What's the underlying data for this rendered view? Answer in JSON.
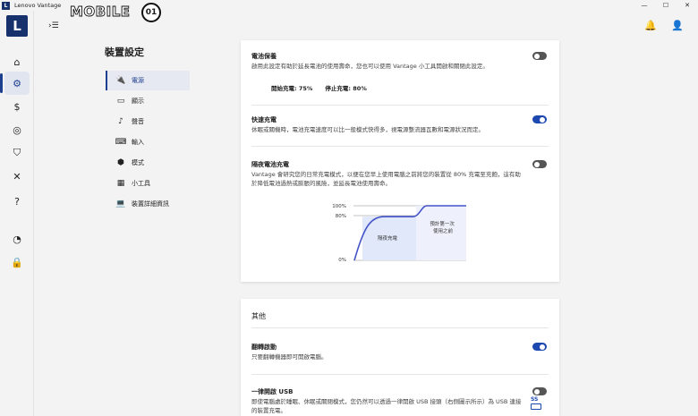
{
  "window": {
    "title": "Lenovo Vantage",
    "badge": "L",
    "minimize": "—",
    "maximize": "☐",
    "close": "✕"
  },
  "watermark": {
    "text": "MOBILE",
    "seal": "01"
  },
  "rail": {
    "logo": "L",
    "icons": [
      {
        "name": "home-icon",
        "glyph": "⌂"
      },
      {
        "name": "gear-icon",
        "glyph": "⚙"
      },
      {
        "name": "dollar-icon",
        "glyph": "$"
      },
      {
        "name": "swirl-icon",
        "glyph": "◎"
      },
      {
        "name": "shield-icon",
        "glyph": "⛉"
      },
      {
        "name": "tools-icon",
        "glyph": "✕"
      },
      {
        "name": "help-icon",
        "glyph": "?"
      },
      {
        "name": "speedometer-icon",
        "glyph": "◔"
      },
      {
        "name": "lock-icon",
        "glyph": "🔒"
      }
    ]
  },
  "header": {
    "expand_icon": "›☰",
    "bell_icon": "🔔",
    "user_icon": "👤"
  },
  "settings_nav": {
    "title": "裝置設定",
    "items": [
      {
        "label": "電源",
        "icon": "🔌"
      },
      {
        "label": "顯示",
        "icon": "▭"
      },
      {
        "label": "聲音",
        "icon": "♪"
      },
      {
        "label": "輸入",
        "icon": "⌨"
      },
      {
        "label": "模式",
        "icon": "⬢"
      },
      {
        "label": "小工具",
        "icon": "▦"
      },
      {
        "label": "裝置詳細資訊",
        "icon": "💻"
      }
    ]
  },
  "power": {
    "battery_care": {
      "title": "電池保養",
      "desc": "啟用此設定有助於延長電池的使用壽命，您也可以使用 Vantage 小工具開啟和關閉此設定。",
      "start_label": "開始充電: 75%",
      "stop_label": "停止充電: 80%",
      "enabled": false
    },
    "rapid_charge": {
      "title": "快速充電",
      "desc": "休眠或關機時，電池充電速度可以比一般模式快得多，視電源整流器瓦數和電源狀況而定。",
      "enabled": true
    },
    "smart_charge": {
      "title": "隔夜電池充電",
      "desc": "Vantage 會研究您的日常充電模式，以便在您早上使用電腦之前將您的裝置從 80% 充電至充飽，這有助於降低電池過熱或膨脹的風險，並延長電池使用壽命。",
      "enabled": false
    }
  },
  "chart_data": {
    "type": "line",
    "title": "",
    "y_ticks": [
      "100%",
      "80%",
      "0%"
    ],
    "ylim": [
      0,
      100
    ],
    "series": [
      {
        "values": [
          0,
          80,
          80,
          100,
          100
        ]
      }
    ],
    "regions": [
      {
        "label": "隔夜充電"
      },
      {
        "label": "預計第一次使用之前"
      }
    ]
  },
  "other": {
    "title": "其他",
    "flip_boot": {
      "title": "翻轉啟動",
      "desc": "只要翻轉機器即可開啟電腦。",
      "enabled": true
    },
    "always_on_usb": {
      "title": "一律開啟 USB",
      "desc": "即使電腦處於睡眠、休眠或關閉模式，您仍然可以透過一律開啟 USB 接頭（右側圖示所示）為 USB 連接的裝置充電。",
      "enabled": false,
      "usb_label": "SS"
    }
  },
  "colors": {
    "accent": "#1d48b0",
    "brand": "#17316c",
    "chart_fill": "#e0e8fa",
    "chart_line": "#4453c7"
  }
}
